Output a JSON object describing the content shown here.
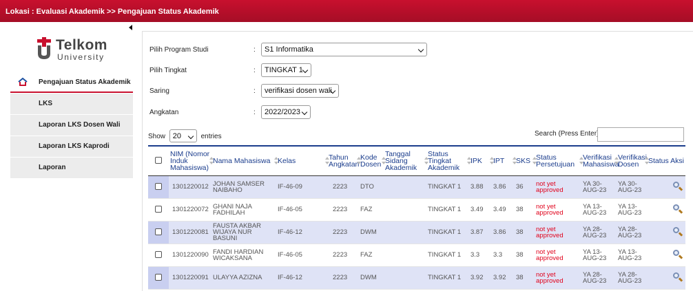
{
  "topbar": {
    "breadcrumb": "Lokasi : Evaluasi Akademik >> Pengajuan Status Akademik"
  },
  "logo": {
    "line1": "Telkom",
    "line2": "University"
  },
  "sidebar": {
    "items": [
      {
        "label": "Pengajuan Status Akademik",
        "active": true
      },
      {
        "label": "LKS"
      },
      {
        "label": "Laporan LKS Dosen Wali"
      },
      {
        "label": "Laporan LKS Kaprodi"
      },
      {
        "label": "Laporan"
      }
    ]
  },
  "filters": {
    "program_label": "Pilih Program Studi",
    "program_value": "S1 Informatika",
    "tingkat_label": "Pilih Tingkat",
    "tingkat_value": "TINGKAT 1",
    "saring_label": "Saring",
    "saring_value": "verifikasi dosen wali",
    "angkatan_label": "Angkatan",
    "angkatan_value": "2022/2023",
    "colon": ":"
  },
  "table_controls": {
    "show_label": "Show",
    "entries_value": "20",
    "entries_label": "entries",
    "search_label": "Search (Press Enter):"
  },
  "columns": [
    "NIM (Nomor Induk Mahasiswa)",
    "Nama Mahasiswa",
    "Kelas",
    "Tahun Angkatan",
    "Kode Dosen",
    "Tanggal Sidang Akademik",
    "Status Tingkat Akademik",
    "IPK",
    "IPT",
    "SKS",
    "Status Persetujuan",
    "Verifikasi Mahasiswa",
    "Verifikasi Dosen",
    "Status Aksi"
  ],
  "rows": [
    {
      "nim": "1301220012",
      "nama": "JOHAN SAMSER NAIBAHO",
      "kelas": "IF-46-09",
      "tahun": "2223",
      "dosen": "DTO",
      "tanggal": "",
      "status": "TINGKAT 1",
      "ipk": "3.88",
      "ipt": "3.86",
      "sks": "36",
      "persetujuan": "not yet approved",
      "ver_mhs": "YA 30-AUG-23",
      "ver_dsn": "YA 30-AUG-23"
    },
    {
      "nim": "1301220072",
      "nama": "GHANI NAJA FADHILAH",
      "kelas": "IF-46-05",
      "tahun": "2223",
      "dosen": "FAZ",
      "tanggal": "",
      "status": "TINGKAT 1",
      "ipk": "3.49",
      "ipt": "3.49",
      "sks": "38",
      "persetujuan": "not yet approved",
      "ver_mhs": "YA 13-AUG-23",
      "ver_dsn": "YA 13-AUG-23"
    },
    {
      "nim": "1301220081",
      "nama": "FAUSTA AKBAR WIJAYA NUR BASUNI",
      "kelas": "IF-46-12",
      "tahun": "2223",
      "dosen": "DWM",
      "tanggal": "",
      "status": "TINGKAT 1",
      "ipk": "3.87",
      "ipt": "3.86",
      "sks": "38",
      "persetujuan": "not yet approved",
      "ver_mhs": "YA 28-AUG-23",
      "ver_dsn": "YA 28-AUG-23"
    },
    {
      "nim": "1301220090",
      "nama": "FANDI HARDIAN WICAKSANA",
      "kelas": "IF-46-05",
      "tahun": "2223",
      "dosen": "FAZ",
      "tanggal": "",
      "status": "TINGKAT 1",
      "ipk": "3.3",
      "ipt": "3.3",
      "sks": "38",
      "persetujuan": "not yet approved",
      "ver_mhs": "YA 13-AUG-23",
      "ver_dsn": "YA 13-AUG-23"
    },
    {
      "nim": "1301220091",
      "nama": "ULAYYA AZIZNA",
      "kelas": "IF-46-12",
      "tahun": "2223",
      "dosen": "DWM",
      "tanggal": "",
      "status": "TINGKAT 1",
      "ipk": "3.92",
      "ipt": "3.92",
      "sks": "38",
      "persetujuan": "not yet approved",
      "ver_mhs": "YA 28-AUG-23",
      "ver_dsn": "YA 28-AUG-23"
    }
  ],
  "colors": {
    "brand_red": "#c8102e",
    "header_blue": "#1a3c8c",
    "row_tint": "#dfe3f6",
    "alert_red": "#e0001a"
  },
  "icons": {
    "home": "home-icon",
    "view": "magnifier-icon",
    "collapse": "collapse-arrow-icon"
  }
}
